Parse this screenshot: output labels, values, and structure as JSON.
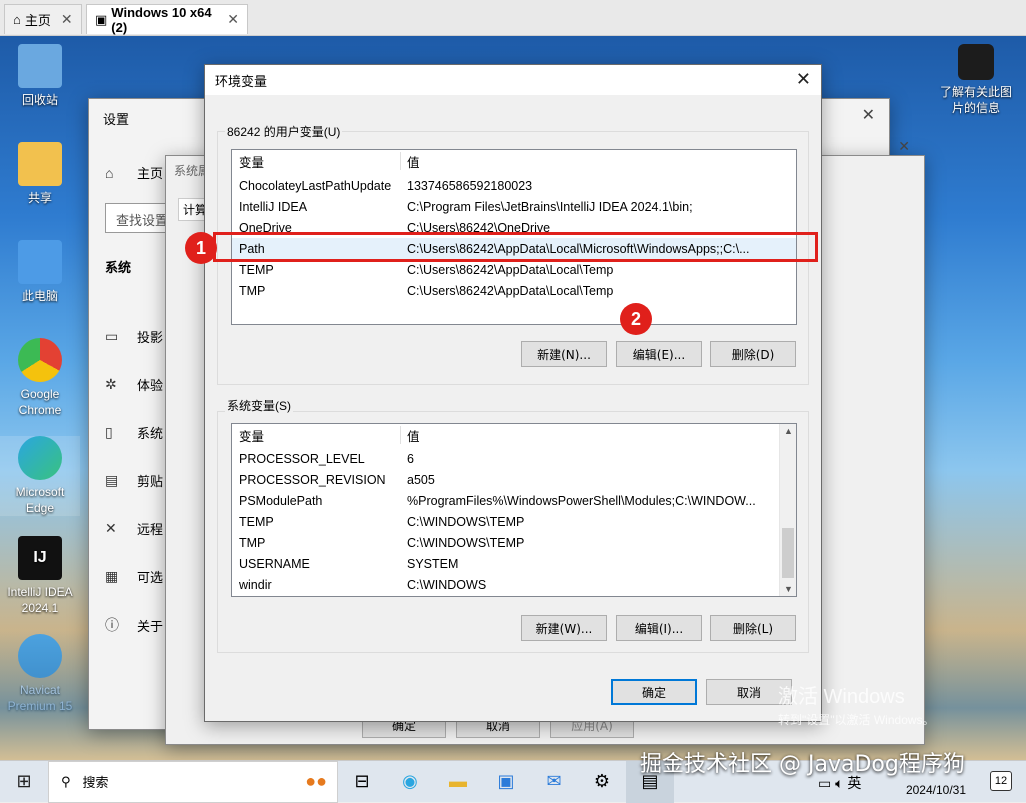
{
  "browser_tabs": [
    {
      "label": "主页"
    },
    {
      "label": "Windows 10 x64 (2)"
    }
  ],
  "desktop_icons": [
    {
      "label": "回收站",
      "color": "#6aa8e0"
    },
    {
      "label": "共享",
      "color": "#f2c14e"
    },
    {
      "label": "此电脑",
      "color": "#4d9be6"
    },
    {
      "label": "Google Chrome",
      "color": "#e34133"
    },
    {
      "label": "Microsoft Edge",
      "color": "#2aa6e0"
    },
    {
      "label": "IntelliJ IDEA 2024.1",
      "color": "#111111"
    },
    {
      "label": "Navicat Premium 15",
      "color": "#4da3e0"
    }
  ],
  "right_icon": {
    "label": "了解有关此图片的信息"
  },
  "settings_window": {
    "title": "设置",
    "home": "主页",
    "search_placeholder": "查找设置",
    "section": "系统",
    "nav": [
      "投影",
      "体验",
      "系统",
      "剪贴",
      "远程",
      "可选",
      "关于"
    ]
  },
  "sys_props": {
    "title": "系统属",
    "tab": "计算",
    "buttons": {
      "ok": "确定",
      "cancel": "取消",
      "apply": "应用(A)"
    }
  },
  "env_dialog": {
    "title": "环境变量",
    "user_group": "86242 的用户变量(U)",
    "col_var": "变量",
    "col_val": "值",
    "user_vars": [
      {
        "name": "ChocolateyLastPathUpdate",
        "value": "133746586592180023"
      },
      {
        "name": "IntelliJ IDEA",
        "value": "C:\\Program Files\\JetBrains\\IntelliJ IDEA 2024.1\\bin;"
      },
      {
        "name": "OneDrive",
        "value": "C:\\Users\\86242\\OneDrive"
      },
      {
        "name": "Path",
        "value": "C:\\Users\\86242\\AppData\\Local\\Microsoft\\WindowsApps;;C:\\..."
      },
      {
        "name": "TEMP",
        "value": "C:\\Users\\86242\\AppData\\Local\\Temp"
      },
      {
        "name": "TMP",
        "value": "C:\\Users\\86242\\AppData\\Local\\Temp"
      }
    ],
    "user_buttons": {
      "new": "新建(N)...",
      "edit": "编辑(E)...",
      "delete": "删除(D)"
    },
    "sys_group": "系统变量(S)",
    "sys_vars": [
      {
        "name": "PROCESSOR_LEVEL",
        "value": "6"
      },
      {
        "name": "PROCESSOR_REVISION",
        "value": "a505"
      },
      {
        "name": "PSModulePath",
        "value": "%ProgramFiles%\\WindowsPowerShell\\Modules;C:\\WINDOW..."
      },
      {
        "name": "TEMP",
        "value": "C:\\WINDOWS\\TEMP"
      },
      {
        "name": "TMP",
        "value": "C:\\WINDOWS\\TEMP"
      },
      {
        "name": "USERNAME",
        "value": "SYSTEM"
      },
      {
        "name": "windir",
        "value": "C:\\WINDOWS"
      }
    ],
    "sys_buttons": {
      "new": "新建(W)...",
      "edit": "编辑(I)...",
      "delete": "删除(L)"
    },
    "ok": "确定",
    "cancel": "取消"
  },
  "annotations": {
    "badge1": "1",
    "badge2": "2",
    "highlight_color": "#e0201b"
  },
  "activate": {
    "title": "激活 Windows",
    "sub": "转到\"设置\"以激活 Windows。"
  },
  "taskbar": {
    "search_label": "搜索",
    "lang": "英",
    "date": "2024/10/31",
    "notif_count": "12"
  },
  "watermark": "掘金技术社区 @ JavaDog程序狗"
}
